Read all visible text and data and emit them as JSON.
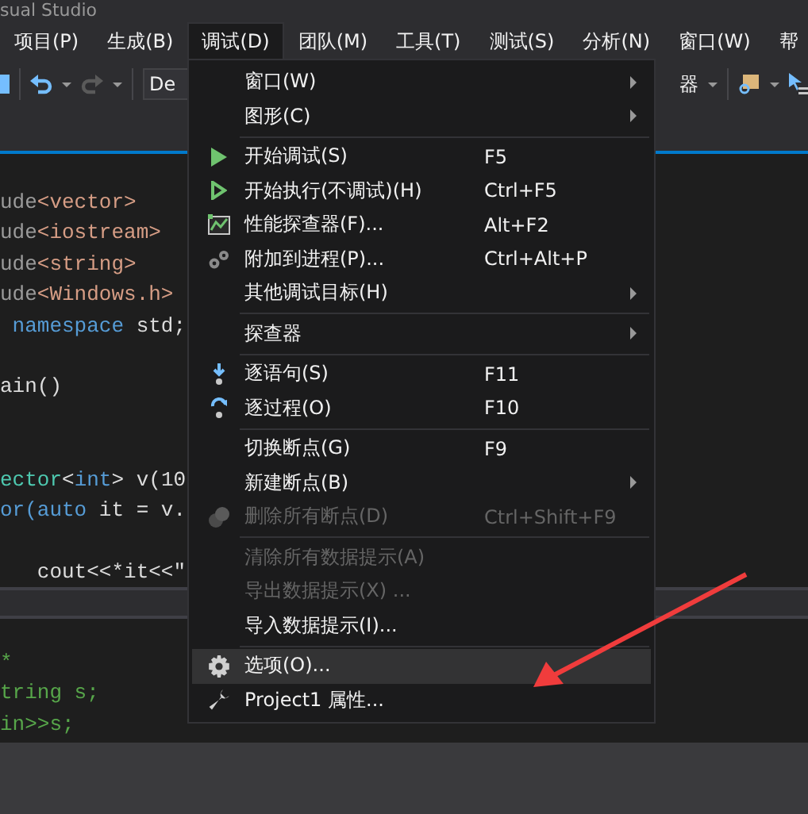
{
  "window": {
    "title": "sual Studio"
  },
  "menu_bar": [
    {
      "label": "项目(P)",
      "selected": false
    },
    {
      "label": "生成(B)",
      "selected": false
    },
    {
      "label": "调试(D)",
      "selected": true
    },
    {
      "label": "团队(M)",
      "selected": false
    },
    {
      "label": "工具(T)",
      "selected": false
    },
    {
      "label": "测试(S)",
      "selected": false
    },
    {
      "label": "分析(N)",
      "selected": false
    },
    {
      "label": "窗口(W)",
      "selected": false
    },
    {
      "label": "帮",
      "selected": false
    }
  ],
  "toolbar": {
    "config_combo": "De",
    "right_combo": "器"
  },
  "editor": {
    "lines": [
      {
        "kind": "code",
        "tokens": [
          {
            "t": "ude",
            "kind": "pp"
          },
          {
            "t": "<vector>",
            "kind": "str"
          }
        ]
      },
      {
        "kind": "code",
        "tokens": [
          {
            "t": "ude",
            "kind": "pp"
          },
          {
            "t": "<iostream>",
            "kind": "str"
          }
        ]
      },
      {
        "kind": "code",
        "tokens": [
          {
            "t": "ude",
            "kind": "pp"
          },
          {
            "t": "<string>",
            "kind": "str"
          }
        ]
      },
      {
        "kind": "code",
        "tokens": [
          {
            "t": "ude",
            "kind": "pp"
          },
          {
            "t": "<Windows.h>",
            "kind": "str"
          }
        ]
      },
      {
        "kind": "code",
        "tokens": [
          {
            "t": " namespace",
            "kind": "kw"
          },
          {
            "t": " std;",
            "kind": "plain"
          }
        ]
      },
      {
        "kind": "blank"
      },
      {
        "kind": "code",
        "tokens": [
          {
            "t": "ain()",
            "kind": "plain"
          }
        ]
      },
      {
        "kind": "blank"
      },
      {
        "kind": "blank"
      },
      {
        "kind": "code",
        "tokens": [
          {
            "t": "ector",
            "kind": "type"
          },
          {
            "t": "<",
            "kind": "plain"
          },
          {
            "t": "int",
            "kind": "kw"
          },
          {
            "t": "> v(10",
            "kind": "plain"
          }
        ]
      },
      {
        "kind": "code",
        "tokens": [
          {
            "t": "or(",
            "kind": "kw"
          },
          {
            "t": "auto",
            "kind": "kw"
          },
          {
            "t": " it = v.",
            "kind": "plain"
          }
        ]
      },
      {
        "kind": "blank"
      },
      {
        "kind": "code",
        "tokens": [
          {
            "t": "   cout<<*it<<\"",
            "kind": "plain"
          }
        ]
      }
    ]
  },
  "output_pane": {
    "lines": [
      {
        "kind": "code",
        "tokens": [
          {
            "t": "*",
            "kind": "comment"
          }
        ]
      },
      {
        "kind": "code",
        "tokens": [
          {
            "t": "tring s;",
            "kind": "comment"
          }
        ]
      },
      {
        "kind": "code",
        "tokens": [
          {
            "t": "in>>s;",
            "kind": "comment"
          }
        ]
      }
    ]
  },
  "debug_menu": {
    "items": [
      {
        "kind": "item",
        "label": "窗口(W)",
        "submenu": true,
        "disabled": false,
        "selected": false
      },
      {
        "kind": "item",
        "label": "图形(C)",
        "submenu": true,
        "disabled": false,
        "selected": false
      },
      {
        "kind": "separator"
      },
      {
        "kind": "item",
        "label": "开始调试(S)",
        "shortcut": "F5",
        "submenu": false,
        "disabled": false,
        "selected": false
      },
      {
        "kind": "item",
        "label": "开始执行(不调试)(H)",
        "shortcut": "Ctrl+F5",
        "submenu": false,
        "disabled": false,
        "selected": false
      },
      {
        "kind": "item",
        "label": "性能探查器(F)...",
        "shortcut": "Alt+F2",
        "submenu": false,
        "disabled": false,
        "selected": false
      },
      {
        "kind": "item",
        "label": "附加到进程(P)...",
        "shortcut": "Ctrl+Alt+P",
        "submenu": false,
        "disabled": false,
        "selected": false
      },
      {
        "kind": "item",
        "label": "其他调试目标(H)",
        "submenu": true,
        "disabled": false,
        "selected": false
      },
      {
        "kind": "separator"
      },
      {
        "kind": "item",
        "label": "探查器",
        "submenu": true,
        "disabled": false,
        "selected": false
      },
      {
        "kind": "separator"
      },
      {
        "kind": "item",
        "label": "逐语句(S)",
        "shortcut": "F11",
        "submenu": false,
        "disabled": false,
        "selected": false
      },
      {
        "kind": "item",
        "label": "逐过程(O)",
        "shortcut": "F10",
        "submenu": false,
        "disabled": false,
        "selected": false
      },
      {
        "kind": "separator"
      },
      {
        "kind": "item",
        "label": "切换断点(G)",
        "shortcut": "F9",
        "submenu": false,
        "disabled": false,
        "selected": false
      },
      {
        "kind": "item",
        "label": "新建断点(B)",
        "submenu": true,
        "disabled": false,
        "selected": false
      },
      {
        "kind": "item",
        "label": "删除所有断点(D)",
        "shortcut": "Ctrl+Shift+F9",
        "submenu": false,
        "disabled": true,
        "selected": false
      },
      {
        "kind": "separator"
      },
      {
        "kind": "item",
        "label": "清除所有数据提示(A)",
        "submenu": false,
        "disabled": true,
        "selected": false
      },
      {
        "kind": "item",
        "label": "导出数据提示(X) ...",
        "submenu": false,
        "disabled": true,
        "selected": false
      },
      {
        "kind": "item",
        "label": "导入数据提示(I)...",
        "submenu": false,
        "disabled": false,
        "selected": false
      },
      {
        "kind": "separator"
      },
      {
        "kind": "item",
        "label": "选项(O)...",
        "submenu": false,
        "disabled": false,
        "selected": true
      },
      {
        "kind": "item",
        "label": "Project1 属性...",
        "submenu": false,
        "disabled": false,
        "selected": false
      }
    ]
  }
}
